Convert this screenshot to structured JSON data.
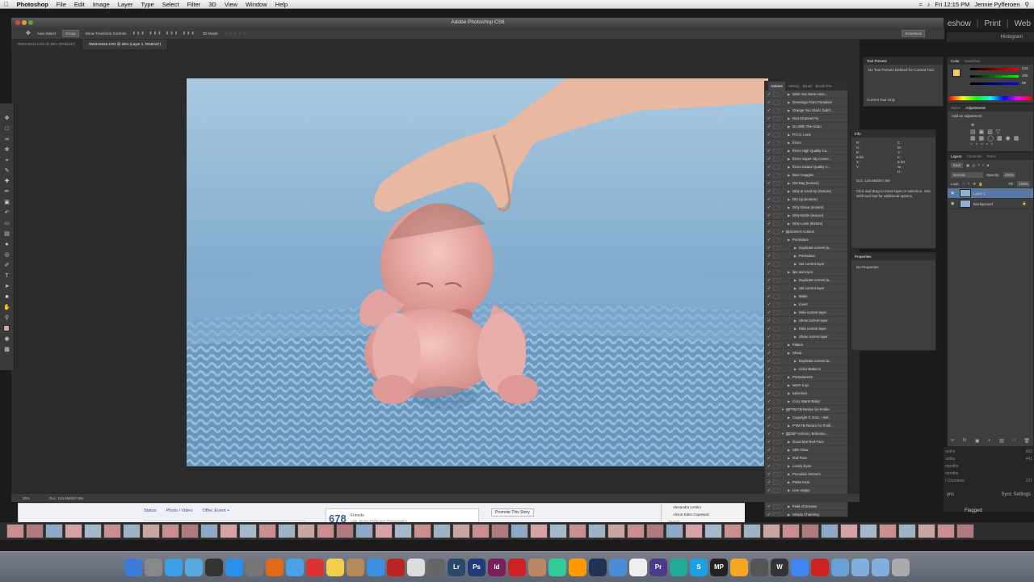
{
  "menubar": {
    "app": "Photoshop",
    "items": [
      "File",
      "Edit",
      "Image",
      "Layer",
      "Type",
      "Select",
      "Filter",
      "3D",
      "View",
      "Window",
      "Help"
    ],
    "clock": "Fri 12:15 PM",
    "user": "Jennie Pyfferoen"
  },
  "window": {
    "title": "Adobe Photoshop CS6"
  },
  "options": {
    "auto_select": "Auto-Select",
    "group": "Group",
    "show_transform": "Show Transform Controls",
    "mode_3d": "3D Mode:",
    "workspace": "Essentials"
  },
  "doc_tabs": [
    {
      "label": "RW3A9316.CR2 @ 25% (RGB/16*)"
    },
    {
      "label": "RW3A9322.CR2 @ 25% (Layer 1, RGB/16*)"
    }
  ],
  "lightroom": {
    "modules": [
      "eshow",
      "Print",
      "Web"
    ],
    "histogram": "Histogram",
    "sync_settings": "Sync Settings",
    "sync": "ync",
    "flagged": "Flagged",
    "folder_rows": [
      "onths",
      "onths",
      "months",
      "months",
      "t Countess",
      "s"
    ],
    "folder_counts": [
      "432",
      "441",
      "",
      "",
      "121",
      ""
    ]
  },
  "actions_panel": {
    "tabs": [
      "Actions",
      "History",
      "Brush",
      "Brush Pre"
    ],
    "items": [
      {
        "label": "Wish You Were Here...",
        "indent": 1
      },
      {
        "label": "Greetings From Paradise!",
        "indent": 1
      },
      {
        "label": "Orange You Glad I Didn't...",
        "indent": 1
      },
      {
        "label": "Red Channel Fix",
        "indent": 1
      },
      {
        "label": "Go With The Grain",
        "indent": 1
      },
      {
        "label": "P.O.S. Lens",
        "indent": 1
      },
      {
        "label": "f/zero",
        "indent": 1
      },
      {
        "label": "f/zero High Quality Ca...",
        "indent": 1
      },
      {
        "label": "f/zero Super HQ Conve...",
        "indent": 1
      },
      {
        "label": "f/zero Insane Quality C...",
        "indent": 1
      },
      {
        "label": "Beer Goggles",
        "indent": 1
      },
      {
        "label": "Dirt Bag (texture)",
        "indent": 1
      },
      {
        "label": "Dirty & Used Up (texture)",
        "indent": 1
      },
      {
        "label": "Dirt Lip (texture)",
        "indent": 1
      },
      {
        "label": "Dirty Diana (texture)",
        "indent": 1
      },
      {
        "label": "Dirty Birdie (texture)",
        "indent": 1
      },
      {
        "label": "Dirty Lovin (texture)",
        "indent": 1
      },
      {
        "label": "Jennie's Actions",
        "indent": 0,
        "folder": true
      },
      {
        "label": "Portraiture",
        "indent": 1
      },
      {
        "label": "Duplicate current la...",
        "indent": 2
      },
      {
        "label": "Portraiture",
        "indent": 2
      },
      {
        "label": "Set current layer",
        "indent": 2
      },
      {
        "label": "lips and eyes",
        "indent": 1
      },
      {
        "label": "Duplicate current la...",
        "indent": 2
      },
      {
        "label": "Set current layer",
        "indent": 2
      },
      {
        "label": "Make",
        "indent": 2
      },
      {
        "label": "Invert",
        "indent": 2
      },
      {
        "label": "Hide current layer",
        "indent": 2
      },
      {
        "label": "Show current layer",
        "indent": 2
      },
      {
        "label": "Hide current layer",
        "indent": 2
      },
      {
        "label": "Show current layer",
        "indent": 2
      },
      {
        "label": "Flatten",
        "indent": 1
      },
      {
        "label": "Sharp",
        "indent": 1
      },
      {
        "label": "Duplicate current la...",
        "indent": 2
      },
      {
        "label": "Color Balance",
        "indent": 2
      },
      {
        "label": "Portraiture25",
        "indent": 1
      },
      {
        "label": "warm it up",
        "indent": 1
      },
      {
        "label": "tuinedout",
        "indent": 1
      },
      {
        "label": "Cozy Warm Baby!",
        "indent": 1
      },
      {
        "label": "PTM FB Resize for Profile",
        "indent": 0,
        "folder": true
      },
      {
        "label": "Copyright © 2011 – Bel...",
        "indent": 1
      },
      {
        "label": "PTM FB Resize for Profil...",
        "indent": 1
      },
      {
        "label": "OSP Actions | Bohemia...",
        "indent": 0,
        "folder": true
      },
      {
        "label": "Good Bye Red Face",
        "indent": 1
      },
      {
        "label": "Skin Glow",
        "indent": 1
      },
      {
        "label": "Owl Face",
        "indent": 1
      },
      {
        "label": "Lovely Eyes",
        "indent": 1
      },
      {
        "label": "Porcelain Veneers",
        "indent": 1
      },
      {
        "label": "Petite treat",
        "indent": 1
      },
      {
        "label": "Live Happy",
        "indent": 1
      },
      {
        "label": "Gracefully Glowing",
        "indent": 1
      },
      {
        "label": "Field of Dreams",
        "indent": 1
      },
      {
        "label": "Simply Charming",
        "indent": 1
      }
    ]
  },
  "tool_presets": {
    "title": "Tool Presets",
    "message": "No Tool Presets Defined for Current Tool.",
    "current_only": "Current Tool Only"
  },
  "info_panel": {
    "title": "Info",
    "rows": [
      "R :",
      "G :",
      "B :",
      "8-bit",
      "C :",
      "M :",
      "Y :",
      "K :",
      "8-bit",
      "X :",
      "Y :",
      "W :",
      "H :"
    ],
    "doc": "Doc: 126.6M/267.9M",
    "hint": "Click and drag to move layer or selection. Use Shift and Opt for additional options."
  },
  "properties_panel": {
    "title": "Properties",
    "message": "No Properties"
  },
  "color_panel": {
    "tabs": [
      "Color",
      "Swatches"
    ],
    "r": "243",
    "g": "206",
    "b": "99"
  },
  "adjust_panel": {
    "tabs": [
      "Styles",
      "Adjustments"
    ],
    "add": "Add an adjustment"
  },
  "layers_panel": {
    "tabs": [
      "Layers",
      "Channels",
      "Paths"
    ],
    "kind": "Kind",
    "blend": "Normal",
    "opacity_label": "Opacity:",
    "opacity": "100%",
    "lock_label": "Lock:",
    "fill_label": "Fill:",
    "fill": "100%",
    "layers": [
      {
        "name": "Layer 1",
        "selected": true
      },
      {
        "name": "Background",
        "selected": false,
        "locked": true
      }
    ]
  },
  "status": {
    "zoom": "25%",
    "doc": "Doc: 126.6M/267.9M"
  },
  "facebook": {
    "status": "Status",
    "photo": "Photo / Video",
    "offer": "Offer, Event +",
    "placeholder": "What have you been up to?",
    "friends_count": "678",
    "friends_label": "Friends",
    "friends_sub": "Like Jennie Pyfferoen Photography",
    "promote": "Promote This Story",
    "chat_names": [
      "Alexandra Lentini",
      "Alison Eden Copeland"
    ],
    "chat_search": "Search"
  },
  "dock_icons": [
    "finder",
    "launchpad",
    "safari",
    "preview",
    "dashboard",
    "app-store",
    "system-prefs",
    "firefox",
    "messages",
    "calendar",
    "notes",
    "contacts",
    "itunes",
    "photo-booth",
    "grapher",
    "utility",
    "lightroom",
    "photoshop",
    "indesign",
    "acrobat",
    "automator",
    "uploader",
    "app",
    "dropbox",
    "folder",
    "app",
    "premiere",
    "app",
    "skype",
    "mp",
    "flower",
    "utilities",
    "wordpress",
    "chrome",
    "acrobat",
    "folder",
    "folder",
    "folder",
    "trash"
  ],
  "colors": {
    "accent": "#5877a3",
    "photo_bg": "#7fa7c9"
  }
}
